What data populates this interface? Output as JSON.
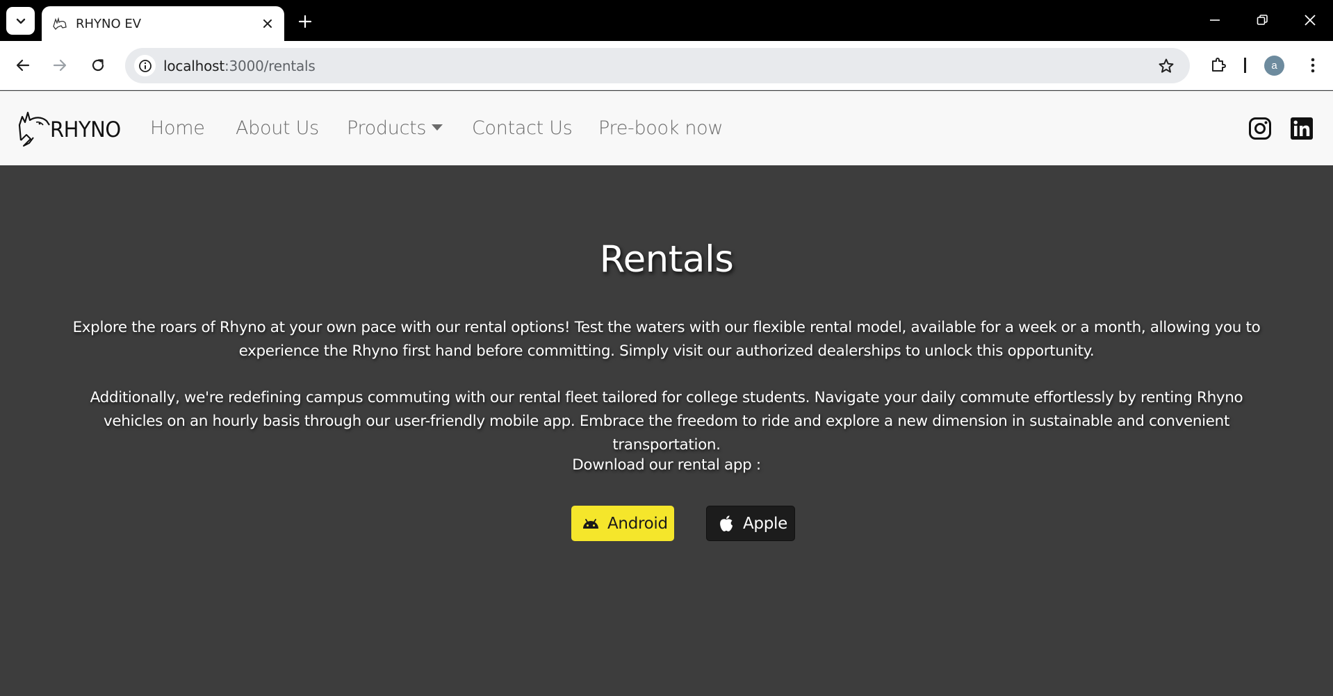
{
  "browser": {
    "tab_title": "RHYNO EV",
    "url_host": "localhost",
    "url_path": ":3000/rentals",
    "profile_initial": "a"
  },
  "navbar": {
    "brand": "RHYNO",
    "links": [
      {
        "label": "Home"
      },
      {
        "label": "About Us"
      },
      {
        "label": "Products"
      },
      {
        "label": "Contact Us"
      },
      {
        "label": "Pre-book now"
      }
    ],
    "social": [
      "instagram-icon",
      "linkedin-icon"
    ]
  },
  "main": {
    "title": "Rentals",
    "paragraph_1": "Explore the roars of Rhyno at your own pace with our rental options! Test the waters with our flexible rental model, available for a week or a month, allowing you to experience the Rhyno first hand before committing. Simply visit our authorized dealerships to unlock this opportunity.",
    "paragraph_2": "Additionally, we're redefining campus commuting with our rental fleet tailored for college students. Navigate your daily commute effortlessly by renting Rhyno vehicles on an hourly basis through our user-friendly mobile app. Embrace the freedom to ride and explore a new dimension in sustainable and convenient transportation.",
    "download_label": "Download our rental app :",
    "buttons": {
      "android": "Android",
      "apple": "Apple"
    }
  },
  "colors": {
    "page_background": "#3d3d3d",
    "navbar_background": "#f8f8f8",
    "android_button": "#f5e62b",
    "apple_button": "#1c1c1c"
  }
}
